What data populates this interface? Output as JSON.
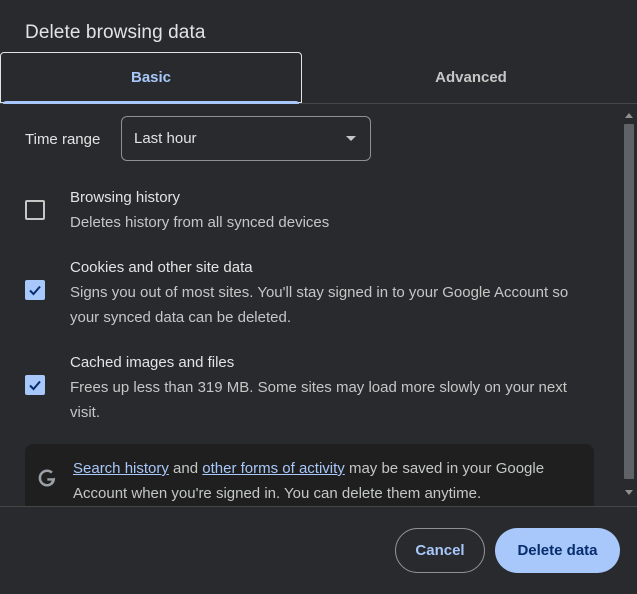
{
  "dialog": {
    "title": "Delete browsing data"
  },
  "tabs": [
    {
      "label": "Basic",
      "selected": true
    },
    {
      "label": "Advanced",
      "selected": false
    }
  ],
  "time_range": {
    "label": "Time range",
    "selected": "Last hour"
  },
  "options": [
    {
      "title": "Browsing history",
      "description": "Deletes history from all synced devices",
      "checked": false
    },
    {
      "title": "Cookies and other site data",
      "description": "Signs you out of most sites. You'll stay signed in to your Google Account so your synced data can be deleted.",
      "checked": true
    },
    {
      "title": "Cached images and files",
      "description": "Frees up less than 319 MB. Some sites may load more slowly on your next visit.",
      "checked": true
    }
  ],
  "info": {
    "icon": "google-g-icon",
    "link1": "Search history",
    "text1": " and ",
    "link2": "other forms of activity",
    "text2": " may be saved in your Google Account when you're signed in. You can delete them anytime."
  },
  "buttons": {
    "cancel": "Cancel",
    "delete": "Delete data"
  },
  "colors": {
    "accent": "#a8c7fa",
    "background": "#282a2d",
    "text": "#e3e3e3"
  }
}
